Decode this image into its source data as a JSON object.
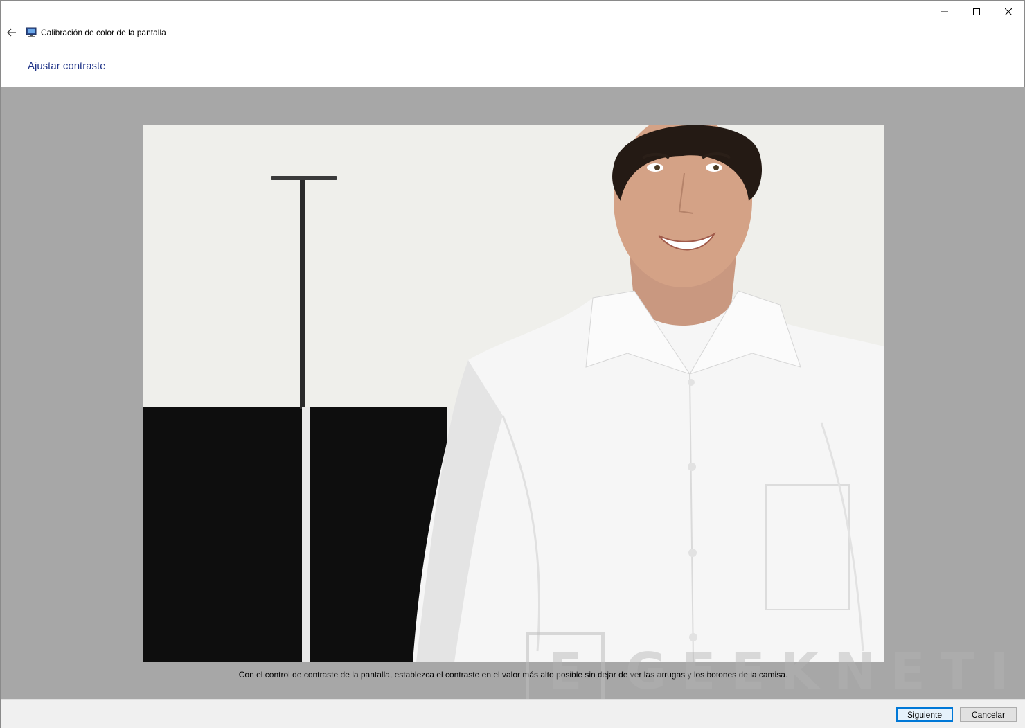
{
  "window": {
    "title": "Calibración de color de la pantalla",
    "controls": [
      "minimize-icon",
      "maximize-icon",
      "close-icon"
    ]
  },
  "page": {
    "heading": "Ajustar contraste",
    "instruction": "Con el control de contraste de la pantalla, establezca el contraste en el valor más alto posible sin dejar de ver las arrugas y los botones de la camisa."
  },
  "watermark": {
    "text": "GEEKNETIC",
    "mark": "E"
  },
  "buttons": {
    "next": "Siguiente",
    "cancel": "Cancelar"
  },
  "colors": {
    "heading": "#1e3287",
    "content_bg": "#a7a7a7",
    "primary_border": "#0078d7"
  }
}
